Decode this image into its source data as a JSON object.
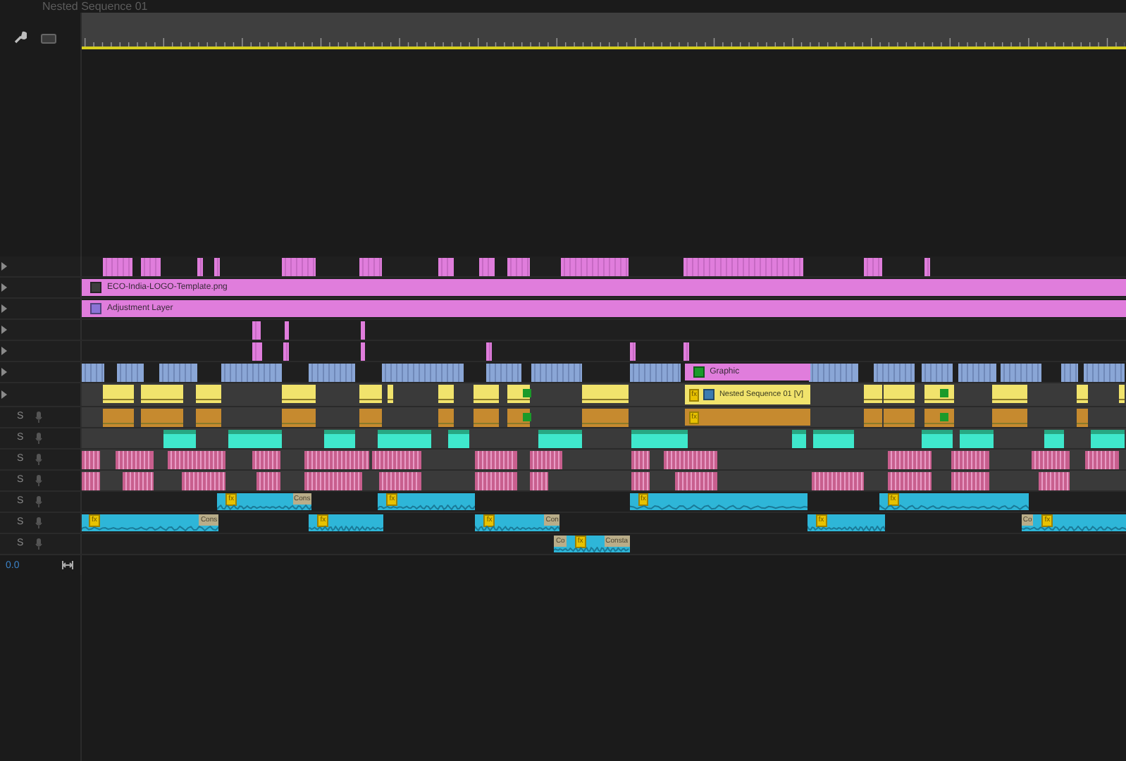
{
  "sequence": {
    "title": "Nested Sequence 01"
  },
  "tracks": [
    {
      "kind": "video",
      "strip": {
        "kind": "striped",
        "color": "#e07ddc"
      }
    },
    {
      "kind": "video",
      "clips": [
        {
          "kind": "image",
          "label": "ECO-India-LOGO-Template.png"
        }
      ]
    },
    {
      "kind": "video",
      "clips": [
        {
          "kind": "adjustment",
          "label": "Adjustment Layer"
        }
      ]
    },
    {
      "kind": "video",
      "strip": {
        "kind": "striped",
        "color": "#e07ddc"
      }
    },
    {
      "kind": "video",
      "strip": {
        "kind": "striped",
        "color": "#e07ddc"
      }
    },
    {
      "kind": "video",
      "strip": {
        "kind": "striped",
        "color": "#8aa6d6"
      },
      "clips": [
        {
          "kind": "graphic",
          "label": "Graphic"
        }
      ]
    },
    {
      "kind": "video",
      "strip": {
        "kind": "banded",
        "color": "#f1e36c"
      },
      "clips": [
        {
          "kind": "nested",
          "badge": "fx",
          "label": "Nested Sequence 01 [V]"
        }
      ]
    },
    {
      "kind": "audio",
      "solo": "S",
      "strip": {
        "kind": "banded",
        "color": "#c68a2f"
      },
      "clips": [
        {
          "kind": "nested",
          "badge": "fx"
        }
      ]
    },
    {
      "kind": "audio",
      "solo": "S",
      "strip": {
        "kind": "capped",
        "color": "#3fe8cc"
      }
    },
    {
      "kind": "audio",
      "solo": "S",
      "strip": {
        "kind": "dense",
        "color": "#c85f8e"
      }
    },
    {
      "kind": "audio",
      "solo": "S",
      "strip": {
        "kind": "dense",
        "color": "#c85f8e"
      }
    },
    {
      "kind": "audio",
      "solo": "S",
      "clips": [
        {
          "kind": "audio",
          "badge": "fx",
          "tail": "Cons"
        },
        {
          "kind": "audio",
          "badge": "fx"
        },
        {
          "kind": "audio",
          "badge": "fx"
        },
        {
          "kind": "audio",
          "badge": "fx"
        }
      ]
    },
    {
      "kind": "audio",
      "solo": "S",
      "clips": [
        {
          "kind": "audio",
          "badge": "fx",
          "tail": "Cons"
        },
        {
          "kind": "audio",
          "badge": "fx"
        },
        {
          "kind": "audio",
          "badge": "fx",
          "tail": "Con"
        },
        {
          "kind": "audio",
          "badge": "fx"
        },
        {
          "kind": "audio",
          "lead": "Co",
          "badge": "fx"
        }
      ]
    },
    {
      "kind": "audio",
      "solo": "S",
      "clips": [
        {
          "kind": "audio",
          "lead": "Co",
          "badge": "fx",
          "tail": "Consta"
        }
      ]
    }
  ],
  "timecode": "0.0"
}
